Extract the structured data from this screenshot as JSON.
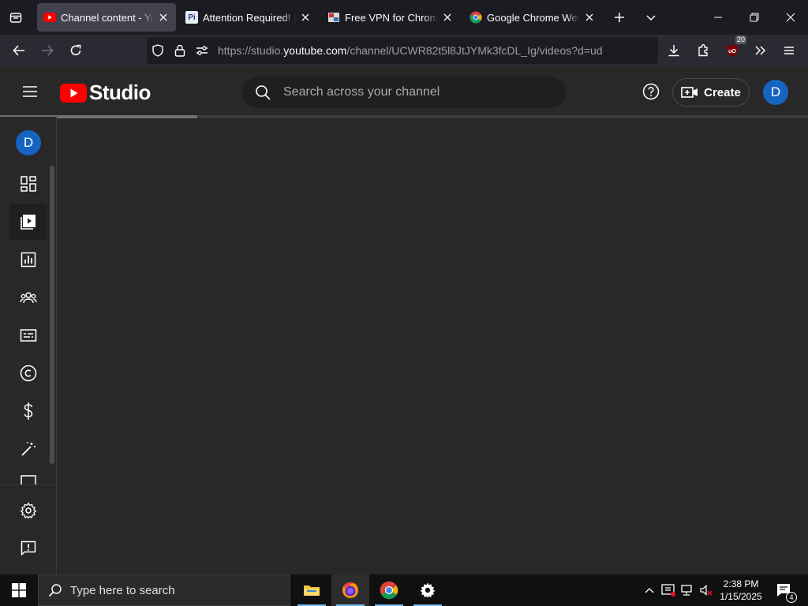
{
  "browser": {
    "tabs": [
      {
        "title": "Channel content - YouTube Studio",
        "favicon": "youtube-icon",
        "active": true
      },
      {
        "title": "Attention Required! | Cloudflare",
        "favicon": "pi-icon",
        "active": false
      },
      {
        "title": "Free VPN for Chrome - VPN Proxy",
        "favicon": "vpn-icon",
        "active": false
      },
      {
        "title": "Google Chrome Web Browser",
        "favicon": "chrome-icon",
        "active": false
      }
    ],
    "url_prefix": "https://studio.",
    "url_domain": "youtube.com",
    "url_path": "/channel/UCWR82t5l8JtJYMk3fcDL_Ig/videos?d=ud",
    "extension_badge": "20"
  },
  "studio": {
    "logo_text": "Studio",
    "search_placeholder": "Search across your channel",
    "create_label": "Create",
    "avatar_letter": "D",
    "loading_progress": 0.244,
    "sidebar_items": [
      {
        "name": "dashboard",
        "icon": "dashboard-icon",
        "active": false
      },
      {
        "name": "content",
        "icon": "content-icon",
        "active": true
      },
      {
        "name": "analytics",
        "icon": "analytics-icon",
        "active": false
      },
      {
        "name": "community",
        "icon": "community-icon",
        "active": false
      },
      {
        "name": "subtitles",
        "icon": "subtitles-icon",
        "active": false
      },
      {
        "name": "copyright",
        "icon": "copyright-icon",
        "active": false
      },
      {
        "name": "earn",
        "icon": "earn-icon",
        "active": false
      },
      {
        "name": "customization",
        "icon": "magic-wand-icon",
        "active": false
      }
    ],
    "sidebar_footer": [
      {
        "name": "settings",
        "icon": "gear-icon"
      },
      {
        "name": "send-feedback",
        "icon": "feedback-icon"
      }
    ]
  },
  "taskbar": {
    "search_text": "Type here to search",
    "time": "2:38 PM",
    "date": "1/15/2025",
    "notification_count": "4",
    "apps": [
      "file-explorer-icon",
      "firefox-icon",
      "chrome-icon",
      "settings-icon"
    ]
  },
  "colors": {
    "youtube_red": "#ff0000",
    "avatar_blue": "#1565c0",
    "studio_bg": "#282828",
    "browser_bg": "#1c1b22"
  }
}
